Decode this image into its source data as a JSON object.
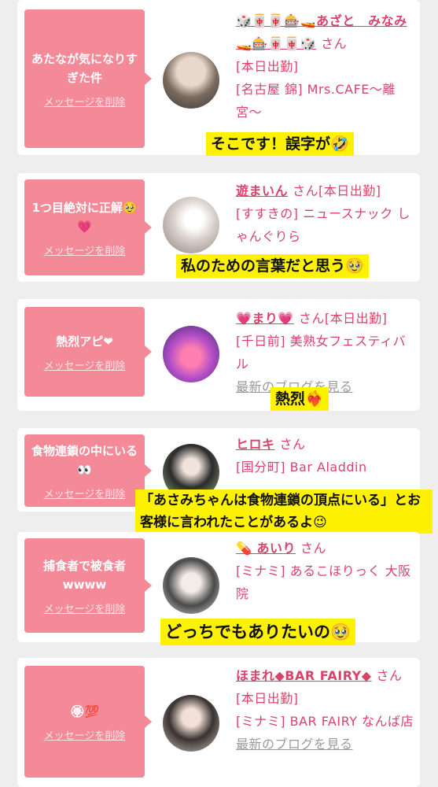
{
  "cards": [
    {
      "message": "あたなが気になりすぎた件",
      "delete_label": "メッセージを削除",
      "name": "🎲🀄🀄🎰🚤あざと　みなみ🚤🎰🀄🀄🎲",
      "san": "さん",
      "status": "[本日出勤]",
      "location": "[名古屋 錦] Mrs.CAFE〜離宮〜",
      "blog": "",
      "caption": "そこです！誤字が🤣"
    },
    {
      "message": "1つ目絶対に正解🥹💗",
      "delete_label": "メッセージを削除",
      "name": "遊まいん",
      "san": "さん",
      "status": "[本日出勤]",
      "location": "[すすきの] ニュースナック しゃんぐりら",
      "blog": "",
      "caption": "私のための言葉だと思う🥹"
    },
    {
      "message": "熱烈アピ❤",
      "delete_label": "メッセージを削除",
      "name": "💗まり💗",
      "san": "さん",
      "status": "[本日出勤]",
      "location": "[千日前] 美熟女フェスティバル",
      "blog": "最新のブログを見る",
      "caption": "熱烈❤️‍🔥"
    },
    {
      "message": "食物連鎖の中にいる👀",
      "delete_label": "メッセージを削除",
      "name": "ヒロキ",
      "san": "さん",
      "status": "",
      "location": "[国分町] Bar Aladdin",
      "blog": "",
      "caption": "「あさみちゃんは食物連鎖の頂点にいる」とお客様に言われたことがあるよ😉"
    },
    {
      "message": "捕食者で被食者wwww",
      "delete_label": "メッセージを削除",
      "name": "💊 あいり",
      "san": "さん",
      "status": "",
      "location": "[ミナミ] あるこほりっく 大阪院",
      "blog": "",
      "caption": "どっちでもありたいの🥹"
    },
    {
      "message": "🏵💯",
      "delete_label": "メッセージを削除",
      "name": "ほまれ◆BAR FAIRY◆",
      "san": "さん",
      "status": "[本日出勤]",
      "location": "[ミナミ] BAR FAIRY なんば店",
      "blog": "最新のブログを見る",
      "caption": ""
    }
  ]
}
